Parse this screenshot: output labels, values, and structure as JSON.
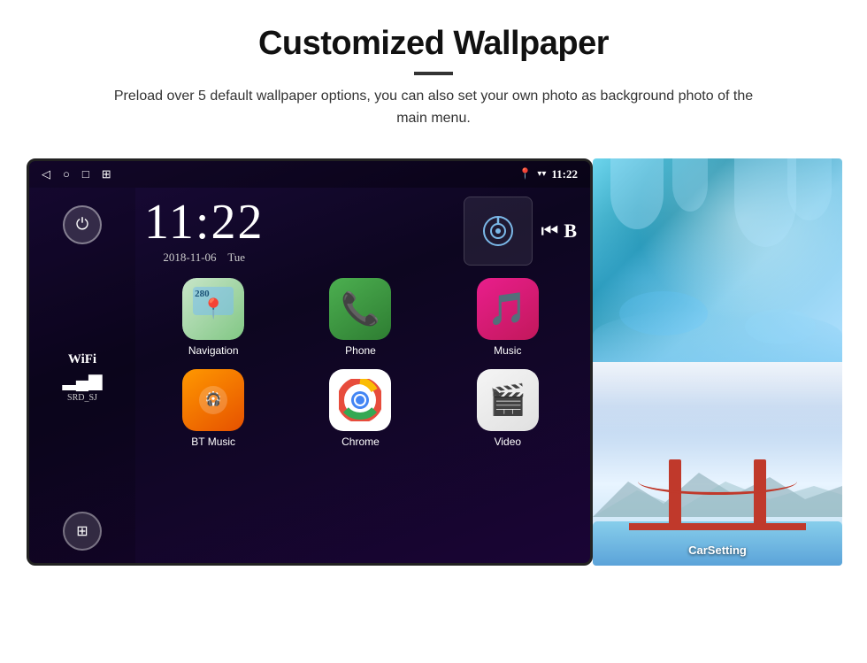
{
  "page": {
    "title": "Customized Wallpaper",
    "divider": "—",
    "subtitle": "Preload over 5 default wallpaper options, you can also set your own photo as background photo of the main menu."
  },
  "android": {
    "statusBar": {
      "time": "11:22",
      "navButtons": [
        "◁",
        "○",
        "□",
        "⊞"
      ],
      "rightIcons": [
        "📍",
        "▾"
      ]
    },
    "clock": {
      "time": "11:22",
      "date": "2018-11-06",
      "day": "Tue"
    },
    "sidebar": {
      "powerLabel": "⏻",
      "wifiLabel": "WiFi",
      "wifiBars": "▂▄▆",
      "wifiSSID": "SRD_SJ",
      "appsGrid": "⊞"
    },
    "apps": [
      {
        "id": "navigation",
        "label": "Navigation",
        "type": "navigation"
      },
      {
        "id": "phone",
        "label": "Phone",
        "type": "phone"
      },
      {
        "id": "music",
        "label": "Music",
        "type": "music"
      },
      {
        "id": "btmusic",
        "label": "BT Music",
        "type": "btmusic"
      },
      {
        "id": "chrome",
        "label": "Chrome",
        "type": "chrome"
      },
      {
        "id": "video",
        "label": "Video",
        "type": "video"
      }
    ],
    "mediaControls": {
      "prev": "⏮",
      "next": "B"
    }
  },
  "wallpapers": {
    "topLabel": "Ice Cave",
    "bottomLabel": "Golden Gate Bridge",
    "carSettingLabel": "CarSetting"
  }
}
